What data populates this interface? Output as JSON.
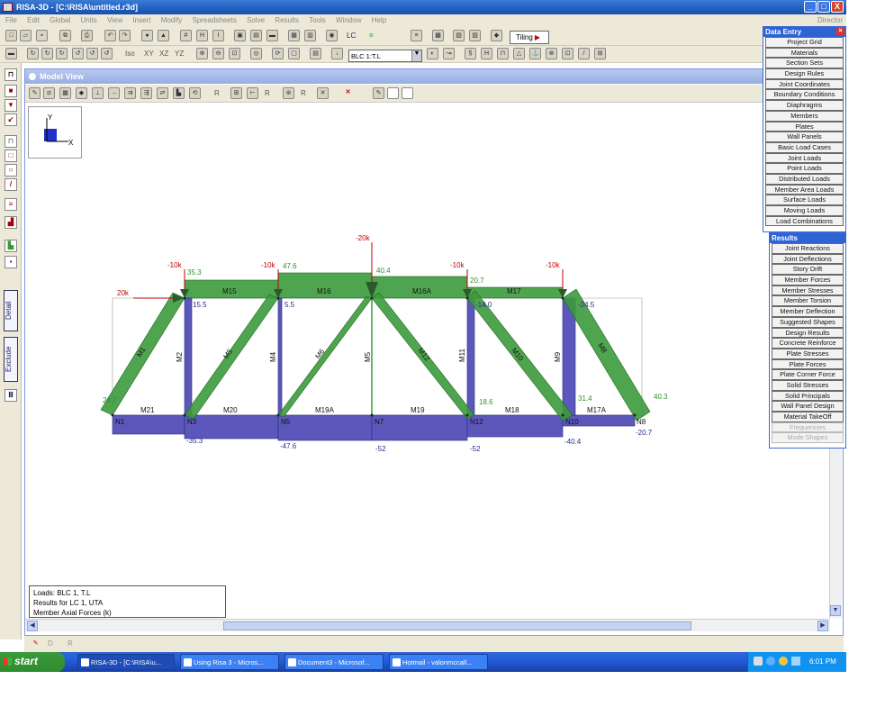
{
  "window": {
    "title": "RISA-3D - [C:\\RISA\\untitled.r3d]",
    "buttons": [
      "_",
      "□",
      "X"
    ]
  },
  "menubar": {
    "items": [
      "File",
      "Edit",
      "Global",
      "Units",
      "View",
      "Insert",
      "Modify",
      "Spreadsheets",
      "Solve",
      "Results",
      "Tools",
      "Window",
      "Help"
    ],
    "right": "Director"
  },
  "toolbar1": {
    "tiling_label": "Tiling",
    "glyphs": [
      "LC",
      "="
    ]
  },
  "toolbar2": {
    "view_labels": [
      "Iso",
      "XY",
      "XZ",
      "YZ"
    ],
    "load_case_select": "BLC 1:T.L"
  },
  "left_toolbar": {
    "tabs": [
      "Detail",
      "Exclude"
    ]
  },
  "model_view": {
    "title": "Model View",
    "toolbar_glyphs": [
      "R",
      "R",
      "R",
      "R"
    ],
    "axis": {
      "y": "Y",
      "x": "X"
    },
    "legend": {
      "line1": "Loads: BLC 1, T.L",
      "line2": "Results for LC 1, UTA",
      "line3": "Member Axial Forces (k)"
    }
  },
  "truss": {
    "joints": [
      "N1",
      "N3",
      "N5",
      "N7",
      "N12",
      "N10",
      "N8"
    ],
    "top_members": [
      "M15",
      "M16",
      "M16A",
      "M17"
    ],
    "bottom_members": [
      "M21",
      "M20",
      "M19A",
      "M19",
      "M18",
      "M17A"
    ],
    "diagonals": [
      "M1",
      "M5",
      "M6",
      "M12",
      "M10",
      "M8"
    ],
    "verticals": [
      "M2",
      "M4",
      "M5",
      "M11",
      "M9"
    ],
    "loads": [
      "20k",
      "-10k",
      "-10k",
      "-20k",
      "-10k",
      "-10k"
    ],
    "top_values": [
      "35.3",
      "47.6",
      "40.4",
      "20.7"
    ],
    "vertical_values": [
      "15.5",
      "5.5",
      "-14.0",
      "-24.5"
    ],
    "diagonal_values": [
      "24.7",
      "18.6",
      "31.4",
      "40.3"
    ],
    "bottom_values": [
      "-35.3",
      "-47.6",
      "-52",
      "-52",
      "-40.4",
      "-20.7"
    ],
    "colors": {
      "tension": "#2f8f2f",
      "compression": "#3d3da8",
      "load_arrow": "#c00000"
    }
  },
  "data_entry": {
    "title": "Data Entry",
    "items": [
      "Project Grid",
      "Materials",
      "Section Sets",
      "Design Rules",
      "Joint Coordinates",
      "Boundary Conditions",
      "Diaphragms",
      "Members",
      "Plates",
      "Wall Panels",
      "Basic Load Cases",
      "Joint Loads",
      "Point Loads",
      "Distributed Loads",
      "Member Area Loads",
      "Surface Loads",
      "Moving Loads",
      "Load Combinations"
    ]
  },
  "results": {
    "title": "Results",
    "items": [
      "Joint Reactions",
      "Joint Deflections",
      "Story Drift",
      "Member Forces",
      "Member Stresses",
      "Member Torsion",
      "Member Deflection",
      "Suggested Shapes",
      "Design Results",
      "Concrete Reinforce",
      "Plate Stresses",
      "Plate Forces",
      "Plate Corner Force",
      "Solid Stresses",
      "Solid Principals",
      "Wall Panel Design",
      "Material TakeOff"
    ],
    "disabled_items": [
      "Frequencies",
      "Mode Shapes"
    ]
  },
  "statusbar": {
    "letters": [
      "D",
      "R"
    ]
  },
  "taskbar": {
    "start": "start",
    "tasks": [
      "RISA-3D - [C:\\RISA\\u...",
      "Using Risa 3 - Micros...",
      "Document3 - Microsof...",
      "Hotmail - valonmccall..."
    ],
    "time": "6:01 PM"
  }
}
